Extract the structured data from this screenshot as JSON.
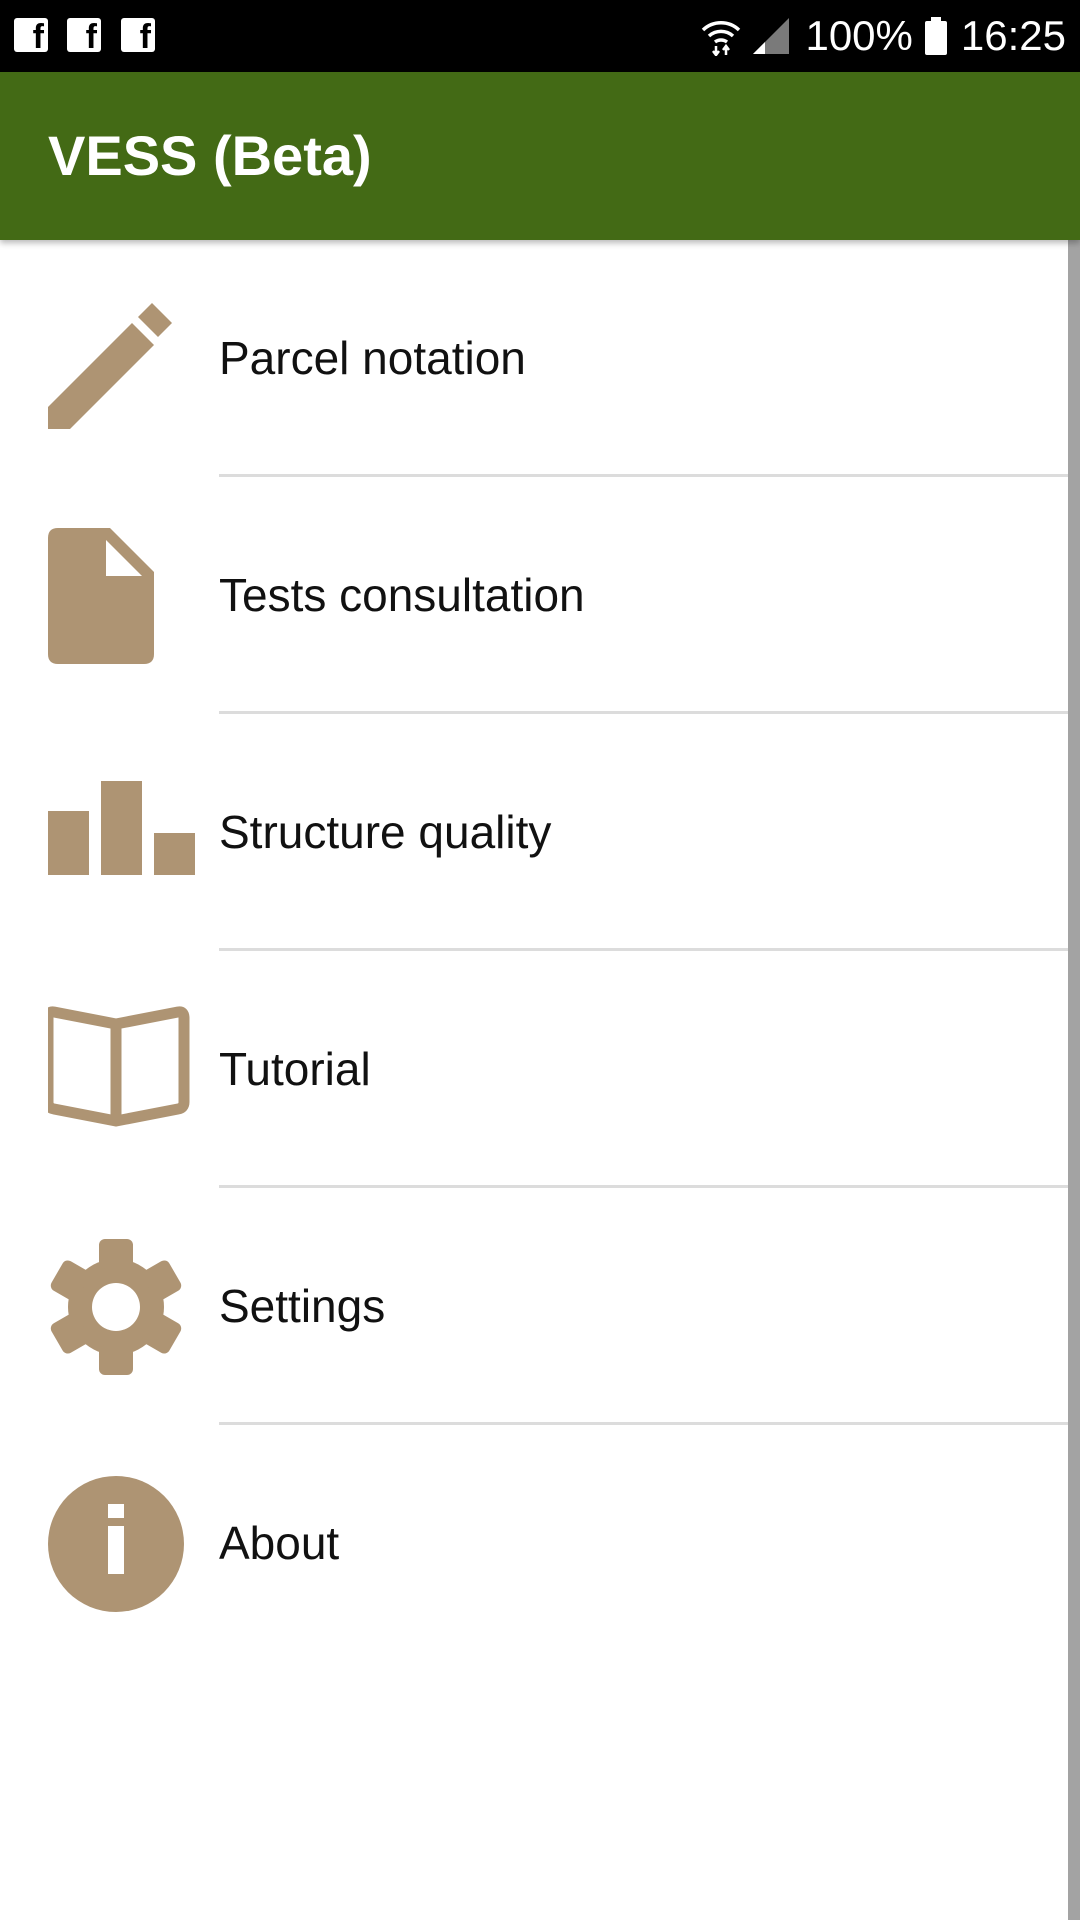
{
  "status_bar": {
    "notification_icons": [
      "facebook-icon",
      "facebook-icon",
      "facebook-icon"
    ],
    "wifi_icon": "wifi-icon",
    "signal_icon": "signal-icon",
    "battery_percent": "100%",
    "battery_icon": "battery-icon",
    "time": "16:25"
  },
  "app_bar": {
    "title": "VESS (Beta)",
    "color": "#436a15"
  },
  "menu": {
    "icon_color": "#ae9473",
    "items": [
      {
        "label": "Parcel notation",
        "icon": "pencil-icon"
      },
      {
        "label": "Tests consultation",
        "icon": "document-icon"
      },
      {
        "label": "Structure quality",
        "icon": "bar-chart-icon"
      },
      {
        "label": "Tutorial",
        "icon": "book-icon"
      },
      {
        "label": "Settings",
        "icon": "gear-icon"
      },
      {
        "label": "About",
        "icon": "info-icon"
      }
    ]
  }
}
